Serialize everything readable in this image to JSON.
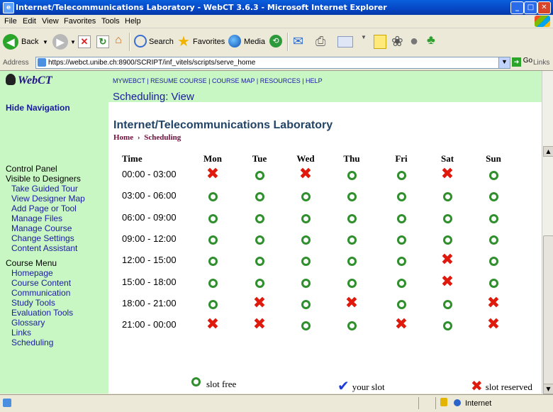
{
  "window": {
    "title": "Internet/Telecommunications Laboratory - WebCT 3.6.3 - Microsoft Internet Explorer"
  },
  "menubar": [
    "File",
    "Edit",
    "View",
    "Favorites",
    "Tools",
    "Help"
  ],
  "toolbar": {
    "back_label": "Back",
    "search_label": "Search",
    "favorites_label": "Favorites",
    "media_label": "Media"
  },
  "address": {
    "label": "Address",
    "url": "https://webct.unibe.ch:8900/SCRIPT/inf_vitels/scripts/serve_home",
    "go_label": "Go",
    "links_label": "Links"
  },
  "nav": {
    "logo": "WebCT",
    "hide_navigation": "Hide Navigation",
    "control_panel": "Control Panel",
    "visible_to_designers": "Visible to Designers",
    "designer_links": [
      "Take Guided Tour",
      "View Designer Map",
      "Add Page or Tool",
      "Manage Files",
      "Manage Course",
      "Change Settings",
      "Content Assistant"
    ],
    "course_menu": "Course Menu",
    "course_links": [
      "Homepage",
      "Course Content",
      "Communication",
      "Study Tools",
      "Evaluation Tools",
      "Glossary",
      "Links",
      "Scheduling"
    ]
  },
  "topbar": {
    "links": "MYWEBCT  |  RESUME COURSE  |  COURSE MAP  |  RESOURCES  |  HELP",
    "page_title": "Scheduling:  View"
  },
  "course_title": "Internet/Telecommunications Laboratory",
  "breadcrumb": {
    "home": "Home",
    "separator": "›",
    "current": "Scheduling"
  },
  "schedule": {
    "time_header": "Time",
    "days": [
      "Mon",
      "Tue",
      "Wed",
      "Thu",
      "Fri",
      "Sat",
      "Sun"
    ],
    "rows": [
      {
        "time": "00:00 - 03:00",
        "slots": [
          "reserved",
          "free",
          "reserved",
          "free",
          "free",
          "reserved",
          "free"
        ]
      },
      {
        "time": "03:00 - 06:00",
        "slots": [
          "free",
          "free",
          "free",
          "free",
          "free",
          "free",
          "free"
        ]
      },
      {
        "time": "06:00 - 09:00",
        "slots": [
          "free",
          "free",
          "free",
          "free",
          "free",
          "free",
          "free"
        ]
      },
      {
        "time": "09:00 - 12:00",
        "slots": [
          "free",
          "free",
          "free",
          "free",
          "free",
          "free",
          "free"
        ]
      },
      {
        "time": "12:00 - 15:00",
        "slots": [
          "free",
          "free",
          "free",
          "free",
          "free",
          "reserved",
          "free"
        ]
      },
      {
        "time": "15:00 - 18:00",
        "slots": [
          "free",
          "free",
          "free",
          "free",
          "free",
          "reserved",
          "free"
        ]
      },
      {
        "time": "18:00 - 21:00",
        "slots": [
          "free",
          "reserved",
          "free",
          "reserved",
          "free",
          "free",
          "reserved"
        ]
      },
      {
        "time": "21:00 - 00:00",
        "slots": [
          "reserved",
          "reserved",
          "free",
          "free",
          "reserved",
          "free",
          "reserved"
        ]
      }
    ]
  },
  "legend": {
    "free": "slot free",
    "yours": "your slot",
    "reserved": "slot reserved"
  },
  "status": {
    "zone": "Internet"
  },
  "colors": {
    "nav_bg": "#c9f7c4",
    "free": "#2f8f2c",
    "reserved": "#e0190d",
    "your_slot": "#1b3cd9",
    "link": "#1a1aa0"
  }
}
